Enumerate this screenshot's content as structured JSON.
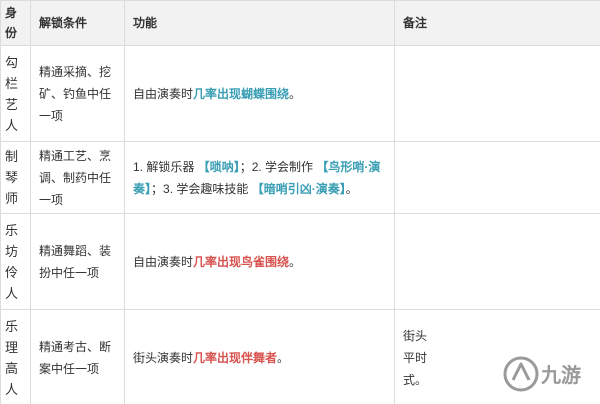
{
  "table": {
    "headers": {
      "role": "身份",
      "condition": "解锁条件",
      "function": "功能",
      "note": "备注"
    },
    "rows": [
      {
        "role": "勾栏艺人",
        "condition": "精通采摘、挖矿、钓鱼中任一项",
        "func_text": "自由演奏时",
        "func_hl": "几率出现蝴蝶围绕",
        "func_end": "。"
      },
      {
        "role": "制琴师",
        "condition": "精通工艺、烹调、制药中任一项",
        "f1": "1. 解锁乐器",
        "f1_hl": "【唢呐】",
        "f2": "；2. 学会制作",
        "f2_hl": "【鸟形哨·演奏】",
        "f3": "；3. 学会趣味技能",
        "f3_hl": "【暗哨引凶·演奏】",
        "f_end": "。"
      },
      {
        "role": "乐坊伶人",
        "condition": "精通舞蹈、装扮中任一项",
        "func_text": "自由演奏时",
        "func_hl": "几率出现鸟雀围绕",
        "func_end": "。"
      },
      {
        "role": "乐理高人",
        "condition": "精通考古、断案中任一项",
        "func_text": "街头演奏时",
        "func_hl": "几率出现伴舞者",
        "func_end": "。",
        "note_l1": "街头",
        "note_l2": "平时",
        "note_l3": "式。"
      }
    ]
  },
  "watermark": {
    "icon": "jiuyou-logo-icon",
    "text": "九游"
  },
  "colors": {
    "header_bg": "#f2f2f2",
    "border": "#dcdcdc",
    "highlight_red": "#d9534f",
    "highlight_teal": "#3a9fb5"
  }
}
